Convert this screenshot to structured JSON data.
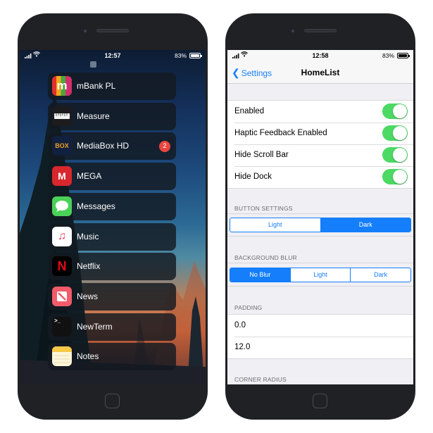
{
  "left_phone": {
    "status": {
      "time": "12:57",
      "battery": "83%"
    },
    "apps": [
      {
        "label": "mBank PL",
        "icon": "mbank-icon",
        "glyph": "m",
        "color": "#c8322b"
      },
      {
        "label": "Measure",
        "icon": "measure-icon",
        "glyph": "",
        "color": "#1c1c1e"
      },
      {
        "label": "MediaBox HD",
        "icon": "mediabox-icon",
        "glyph": "BOX",
        "color": "#10203e",
        "badge": "2"
      },
      {
        "label": "MEGA",
        "icon": "mega-icon",
        "glyph": "M",
        "color": "#d9272e"
      },
      {
        "label": "Messages",
        "icon": "messages-icon",
        "glyph": "",
        "color": "#4ad158"
      },
      {
        "label": "Music",
        "icon": "music-icon",
        "glyph": "♫",
        "color": "#ffffff"
      },
      {
        "label": "Netflix",
        "icon": "netflix-icon",
        "glyph": "N",
        "color": "#000000"
      },
      {
        "label": "News",
        "icon": "news-icon",
        "glyph": "",
        "color": "#f25b6a"
      },
      {
        "label": "NewTerm",
        "icon": "terminal-icon",
        "glyph": ">_",
        "color": "#111111"
      },
      {
        "label": "Notes",
        "icon": "notes-icon",
        "glyph": "",
        "color": "#fdf6d6"
      }
    ]
  },
  "right_phone": {
    "status": {
      "time": "12:58",
      "battery": "83%"
    },
    "nav": {
      "back": "Settings",
      "title": "HomeList"
    },
    "toggles": [
      {
        "label": "Enabled",
        "on": true
      },
      {
        "label": "Haptic Feedback Enabled",
        "on": true
      },
      {
        "label": "Hide Scroll Bar",
        "on": true
      },
      {
        "label": "Hide Dock",
        "on": true
      }
    ],
    "button_settings": {
      "header": "BUTTON SETTINGS",
      "options": [
        "Light",
        "Dark"
      ],
      "selected": "Dark"
    },
    "background_blur": {
      "header": "BACKGROUND BLUR",
      "options": [
        "No Blur",
        "Light",
        "Dark"
      ],
      "selected": "No Blur"
    },
    "padding": {
      "header": "PADDING",
      "values": [
        "0.0",
        "12.0"
      ]
    },
    "corner_radius": {
      "header": "CORNER RADIUS"
    }
  },
  "colors": {
    "accent": "#147efb",
    "toggle_on": "#4cd964",
    "badge": "#e8463f"
  }
}
